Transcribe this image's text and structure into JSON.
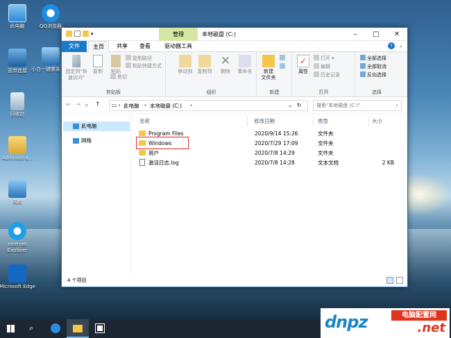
{
  "desktop": {
    "icons": [
      {
        "label": "此电脑",
        "icon": "computer-icon"
      },
      {
        "label": "QQ浏览器",
        "icon": "qq-browser-icon"
      },
      {
        "label": "宽带连接",
        "icon": "broadband-connection-icon"
      },
      {
        "label": "小白一键重装系统",
        "icon": "reinstall-tool-icon"
      },
      {
        "label": "回收站",
        "icon": "recycle-bin-icon"
      },
      {
        "label": "Administra...",
        "icon": "user-folder-icon"
      },
      {
        "label": "网络",
        "icon": "network-icon"
      },
      {
        "label": "Internet Explorer",
        "icon": "internet-explorer-icon"
      },
      {
        "label": "Microsoft Edge",
        "icon": "edge-icon"
      }
    ]
  },
  "window": {
    "context_tab": "管理",
    "title": "本地磁盘 (C:)",
    "ribbon_tabs": [
      "文件",
      "主页",
      "共享",
      "查看",
      "驱动器工具"
    ],
    "groups": {
      "clipboard": {
        "label": "剪贴板",
        "pin": "固定到\"快速访问\"",
        "copy": "复制",
        "paste": "粘贴",
        "copy_path": "复制路径",
        "paste_shortcut": "粘贴快捷方式",
        "cut": "剪切"
      },
      "organize": {
        "label": "组织",
        "move_to": "移动到",
        "copy_to": "复制到",
        "delete": "删除",
        "rename": "重命名"
      },
      "new": {
        "label": "新建",
        "new_folder": "新建\n文件夹"
      },
      "open": {
        "label": "打开",
        "properties": "属性",
        "open": "打开",
        "edit": "编辑",
        "history": "历史记录"
      },
      "select": {
        "label": "选择",
        "select_all": "全部选择",
        "select_none": "全部取消",
        "invert": "反向选择"
      }
    },
    "breadcrumb": [
      "此电脑",
      "本地磁盘 (C:)"
    ],
    "search_placeholder": "搜索\"本地磁盘 (C:)\"",
    "nav": [
      {
        "label": "此电脑",
        "selected": true
      },
      {
        "label": "网络",
        "selected": false
      }
    ],
    "columns": [
      "名称",
      "修改日期",
      "类型",
      "大小"
    ],
    "files": [
      {
        "name": "Program Files",
        "date": "2020/9/14 15:26",
        "type": "文件夹",
        "size": ""
      },
      {
        "name": "Windows",
        "date": "2020/7/29 17:09",
        "type": "文件夹",
        "size": ""
      },
      {
        "name": "用户",
        "date": "2020/7/8 14:29",
        "type": "文件夹",
        "size": ""
      },
      {
        "name": "激活日志.log",
        "date": "2020/7/8 14:28",
        "type": "文本文档",
        "size": "2 KB"
      }
    ],
    "status": "4 个项目"
  },
  "watermark": {
    "brand": "dnpz",
    "label": "电脑配置网",
    "suffix": ".net"
  },
  "colors": {
    "accent": "#1979ca",
    "selected": "#cce8ff",
    "folder": "#f4c64c",
    "highlight_box": "#e02020",
    "context_tab": "#d5e7a3",
    "taskbar": "#1c2733"
  }
}
